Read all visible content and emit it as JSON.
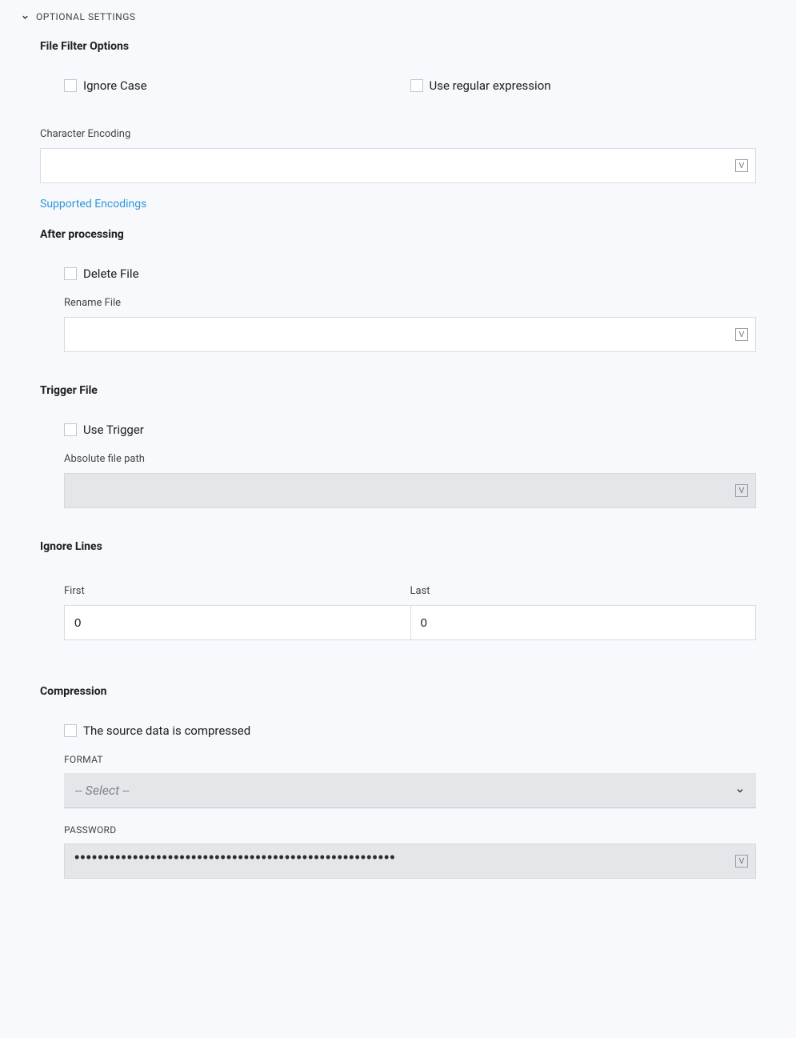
{
  "header": {
    "title": "OPTIONAL SETTINGS"
  },
  "fileFilter": {
    "heading": "File Filter Options",
    "ignoreCase": {
      "label": "Ignore Case",
      "checked": false
    },
    "useRegex": {
      "label": "Use regular expression",
      "checked": false
    },
    "encodingLabel": "Character Encoding",
    "encodingValue": "",
    "supportedLink": "Supported Encodings"
  },
  "afterProcessing": {
    "heading": "After processing",
    "deleteFile": {
      "label": "Delete File",
      "checked": false
    },
    "renameLabel": "Rename File",
    "renameValue": ""
  },
  "triggerFile": {
    "heading": "Trigger File",
    "useTrigger": {
      "label": "Use Trigger",
      "checked": false
    },
    "pathLabel": "Absolute file path",
    "pathValue": ""
  },
  "ignoreLines": {
    "heading": "Ignore Lines",
    "firstLabel": "First",
    "lastLabel": "Last",
    "firstValue": "0",
    "lastValue": "0"
  },
  "compression": {
    "heading": "Compression",
    "compressed": {
      "label": "The source data is compressed",
      "checked": false
    },
    "formatLabel": "FORMAT",
    "formatPlaceholder": "-- Select --",
    "passwordLabel": "PASSWORD",
    "passwordMask": "•••••••••••••••••••••••••••••••••••••••••••••••••••••••"
  }
}
